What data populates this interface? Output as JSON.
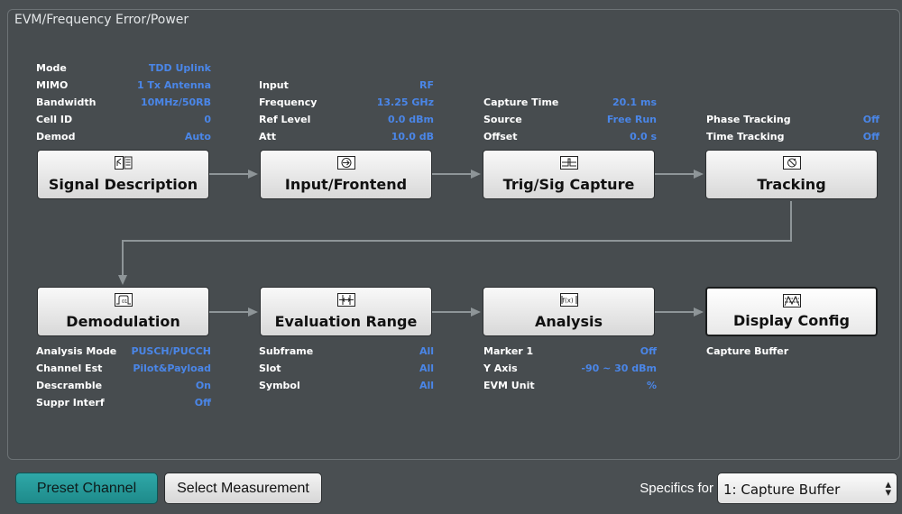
{
  "panel": {
    "title": "EVM/Frequency Error/Power"
  },
  "signal_info": [
    {
      "label": "Mode",
      "value": "TDD Uplink"
    },
    {
      "label": "MIMO",
      "value": "1 Tx Antenna"
    },
    {
      "label": "Bandwidth",
      "value": "10MHz/50RB"
    },
    {
      "label": "Cell ID",
      "value": "0"
    },
    {
      "label": "Demod",
      "value": "Auto"
    }
  ],
  "input_info": [
    {
      "label": "Input",
      "value": "RF"
    },
    {
      "label": "Frequency",
      "value": "13.25 GHz"
    },
    {
      "label": "Ref Level",
      "value": "0.0 dBm"
    },
    {
      "label": "Att",
      "value": "10.0 dB"
    }
  ],
  "capture_info": [
    {
      "label": "Capture Time",
      "value": "20.1 ms"
    },
    {
      "label": "Source",
      "value": "Free Run"
    },
    {
      "label": "Offset",
      "value": "0.0 s"
    }
  ],
  "tracking_info": [
    {
      "label": "Phase Tracking",
      "value": "Off"
    },
    {
      "label": "Time Tracking",
      "value": "Off"
    }
  ],
  "blocks_row1": [
    {
      "label": "Signal Description",
      "icon": "signal-description-icon"
    },
    {
      "label": "Input/Frontend",
      "icon": "input-frontend-icon"
    },
    {
      "label": "Trig/Sig Capture",
      "icon": "trigger-capture-icon"
    },
    {
      "label": "Tracking",
      "icon": "tracking-icon"
    }
  ],
  "blocks_row2": [
    {
      "label": "Demodulation",
      "icon": "demodulation-icon"
    },
    {
      "label": "Evaluation Range",
      "icon": "evaluation-range-icon"
    },
    {
      "label": "Analysis",
      "icon": "analysis-icon"
    },
    {
      "label": "Display Config",
      "icon": "display-config-icon"
    }
  ],
  "demod_info": [
    {
      "label": "Analysis Mode",
      "value": "PUSCH/PUCCH"
    },
    {
      "label": "Channel Est",
      "value": "Pilot&Payload"
    },
    {
      "label": "Descramble",
      "value": "On"
    },
    {
      "label": "Suppr Interf",
      "value": "Off"
    }
  ],
  "eval_info": [
    {
      "label": "Subframe",
      "value": "All"
    },
    {
      "label": "Slot",
      "value": "All"
    },
    {
      "label": "Symbol",
      "value": "All"
    }
  ],
  "analysis_info": [
    {
      "label": "Marker 1",
      "value": "Off"
    },
    {
      "label": "Y Axis",
      "value": "-90 ~ 30 dBm"
    },
    {
      "label": "EVM Unit",
      "value": "%"
    }
  ],
  "display_info": [
    {
      "label": "Capture Buffer"
    }
  ],
  "footer": {
    "preset_label": "Preset Channel",
    "select_measurement_label": "Select Measurement",
    "specifics_label": "Specifics for",
    "specifics_value": "1: Capture Buffer"
  },
  "colors": {
    "value_blue": "#4a86e8",
    "preset_teal": "#2fa8a8",
    "background": "#4a4f52"
  }
}
